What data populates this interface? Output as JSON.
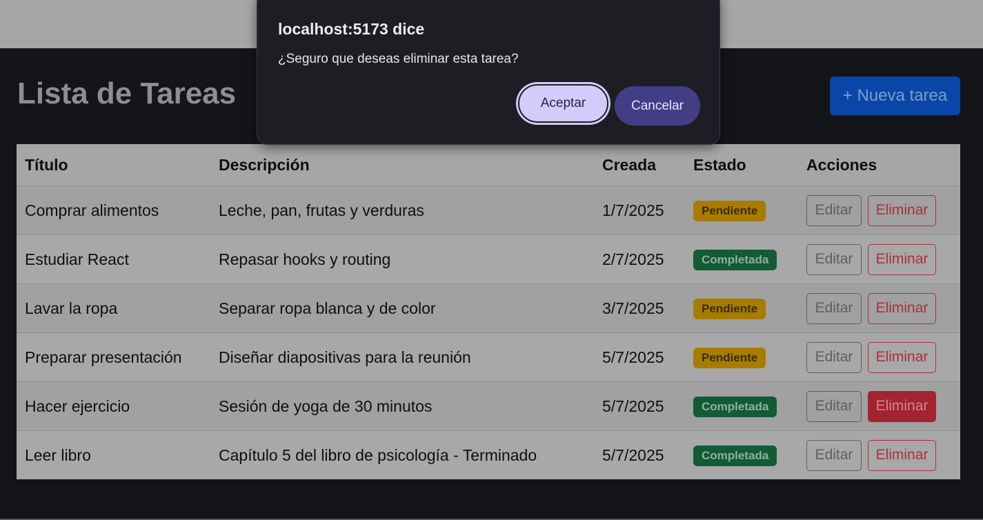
{
  "page": {
    "title": "Lista de Tareas",
    "new_task_label": "+ Nueva tarea"
  },
  "table": {
    "headers": [
      "Título",
      "Descripción",
      "Creada",
      "Estado",
      "Acciones"
    ],
    "rows": [
      {
        "title": "Comprar alimentos",
        "description": "Leche, pan, frutas y verduras",
        "created": "1/7/2025",
        "status": "Pendiente"
      },
      {
        "title": "Estudiar React",
        "description": "Repasar hooks y routing",
        "created": "2/7/2025",
        "status": "Completada"
      },
      {
        "title": "Lavar la ropa",
        "description": "Separar ropa blanca y de color",
        "created": "3/7/2025",
        "status": "Pendiente"
      },
      {
        "title": "Preparar presentación",
        "description": "Diseñar diapositivas para la reunión",
        "created": "5/7/2025",
        "status": "Pendiente"
      },
      {
        "title": "Hacer ejercicio",
        "description": "Sesión de yoga de 30 minutos",
        "created": "5/7/2025",
        "status": "Completada"
      },
      {
        "title": "Leer libro",
        "description": "Capítulo 5 del libro de psicología - Terminado",
        "created": "5/7/2025",
        "status": "Completada"
      }
    ],
    "edit_label": "Editar",
    "delete_label": "Eliminar"
  },
  "dialog": {
    "title": "localhost:5173 dice",
    "message": "¿Seguro que deseas eliminar esta tarea?",
    "ok_label": "Aceptar",
    "cancel_label": "Cancelar"
  },
  "colors": {
    "primary": "#0d6efd",
    "danger": "#dc3545",
    "warning": "#ffc107",
    "success": "#198754",
    "dialog_accept": "#d2ccfb",
    "dialog_cancel": "#433d86"
  }
}
